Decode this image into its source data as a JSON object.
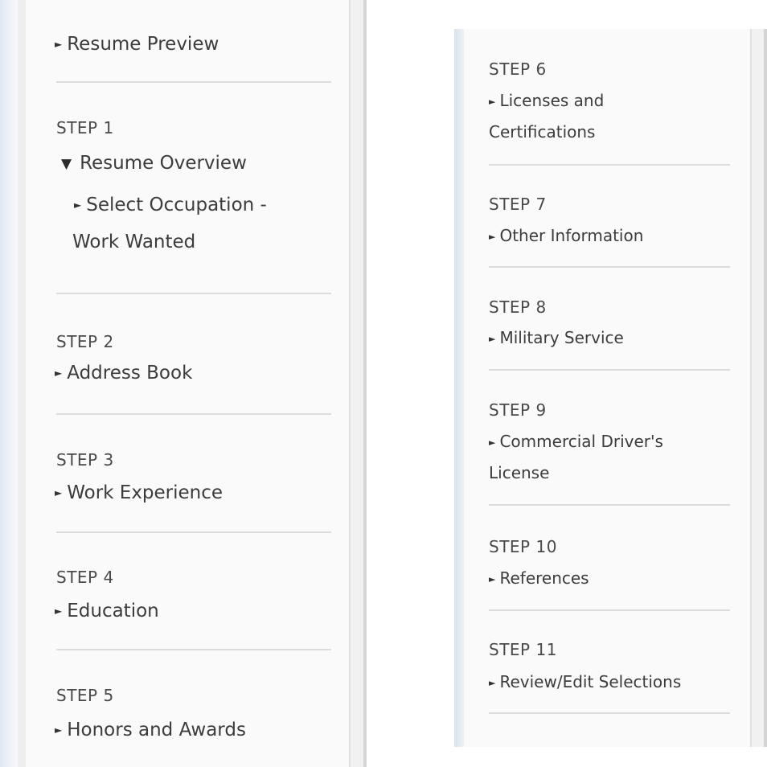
{
  "left_panel": {
    "resume_preview": "Resume Preview",
    "step1": {
      "step": "STEP 1",
      "label": "Resume Overview",
      "sub_line1": "Select Occupation -",
      "sub_line2": "Work Wanted"
    },
    "step2": {
      "step": "STEP 2",
      "label": "Address Book"
    },
    "step3": {
      "step": "STEP 3",
      "label": "Work Experience"
    },
    "step4": {
      "step": "STEP 4",
      "label": "Education"
    },
    "step5": {
      "step": "STEP 5",
      "label": "Honors and Awards"
    }
  },
  "right_panel": {
    "step6": {
      "step": "STEP 6",
      "label_line1": "Licenses and",
      "label_line2": "Certifications"
    },
    "step7": {
      "step": "STEP 7",
      "label": "Other Information"
    },
    "step8": {
      "step": "STEP 8",
      "label": "Military Service"
    },
    "step9": {
      "step": "STEP 9",
      "label_line1": "Commercial Driver's",
      "label_line2": "License"
    },
    "step10": {
      "step": "STEP 10",
      "label": "References"
    },
    "step11": {
      "step": "STEP 11",
      "label": "Review/Edit Selections"
    }
  },
  "icons": {
    "collapsed": "triangle-right-icon",
    "expanded": "triangle-down-icon"
  }
}
